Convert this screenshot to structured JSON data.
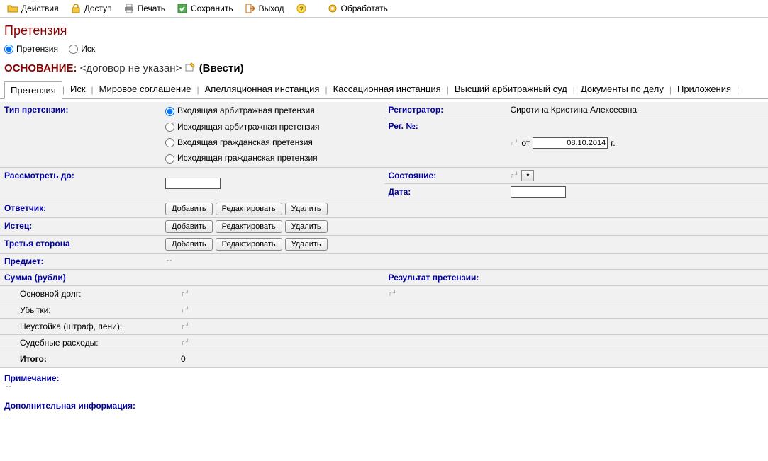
{
  "toolbar": {
    "actions": "Действия",
    "access": "Доступ",
    "print": "Печать",
    "save": "Сохранить",
    "exit": "Выход",
    "help": "",
    "process": "Обработать"
  },
  "title": "Претензия",
  "doc_type": {
    "pretension": "Претензия",
    "lawsuit": "Иск"
  },
  "basis": {
    "label": "ОСНОВАНИЕ:",
    "value": "<договор не указан>",
    "action": "(Ввести)"
  },
  "tabs": {
    "pretension": "Претензия",
    "lawsuit": "Иск",
    "settlement": "Мировое соглашение",
    "appeal": "Апелляционная инстанция",
    "cassation": "Кассационная инстанция",
    "supreme": "Высший арбитражный суд",
    "documents": "Документы по делу",
    "attachments": "Приложения"
  },
  "form": {
    "type_label": "Тип претензии:",
    "type_options": {
      "in_arb": "Входящая арбитражная претензия",
      "out_arb": "Исходящая арбитражная претензия",
      "in_civ": "Входящая гражданская претензия",
      "out_civ": "Исходящая гражданская претензия"
    },
    "registrar_label": "Регистратор:",
    "registrar_value": "Сиротина Кристина Алексеевна",
    "regnum_label": "Рег. №:",
    "regnum_from": "от",
    "regnum_date": "08.10.2014",
    "regnum_suffix": "г.",
    "consider_label": "Рассмотреть до:",
    "state_label": "Состояние:",
    "date_label": "Дата:",
    "defendant_label": "Ответчик:",
    "plaintiff_label": "Истец:",
    "thirdparty_label": "Третья сторона",
    "subject_label": "Предмет:",
    "sum_label": "Сумма (рубли)",
    "main_debt": "Основной долг:",
    "losses": "Убытки:",
    "penalty": "Неустойка (штраф, пени):",
    "court_costs": "Судебные расходы:",
    "total_label": "Итого:",
    "total_value": "0",
    "result_label": "Результат претензии:",
    "note_label": "Примечание:",
    "extra_label": "Дополнительная информация:",
    "btn_add": "Добавить",
    "btn_edit": "Редактировать",
    "btn_delete": "Удалить"
  }
}
